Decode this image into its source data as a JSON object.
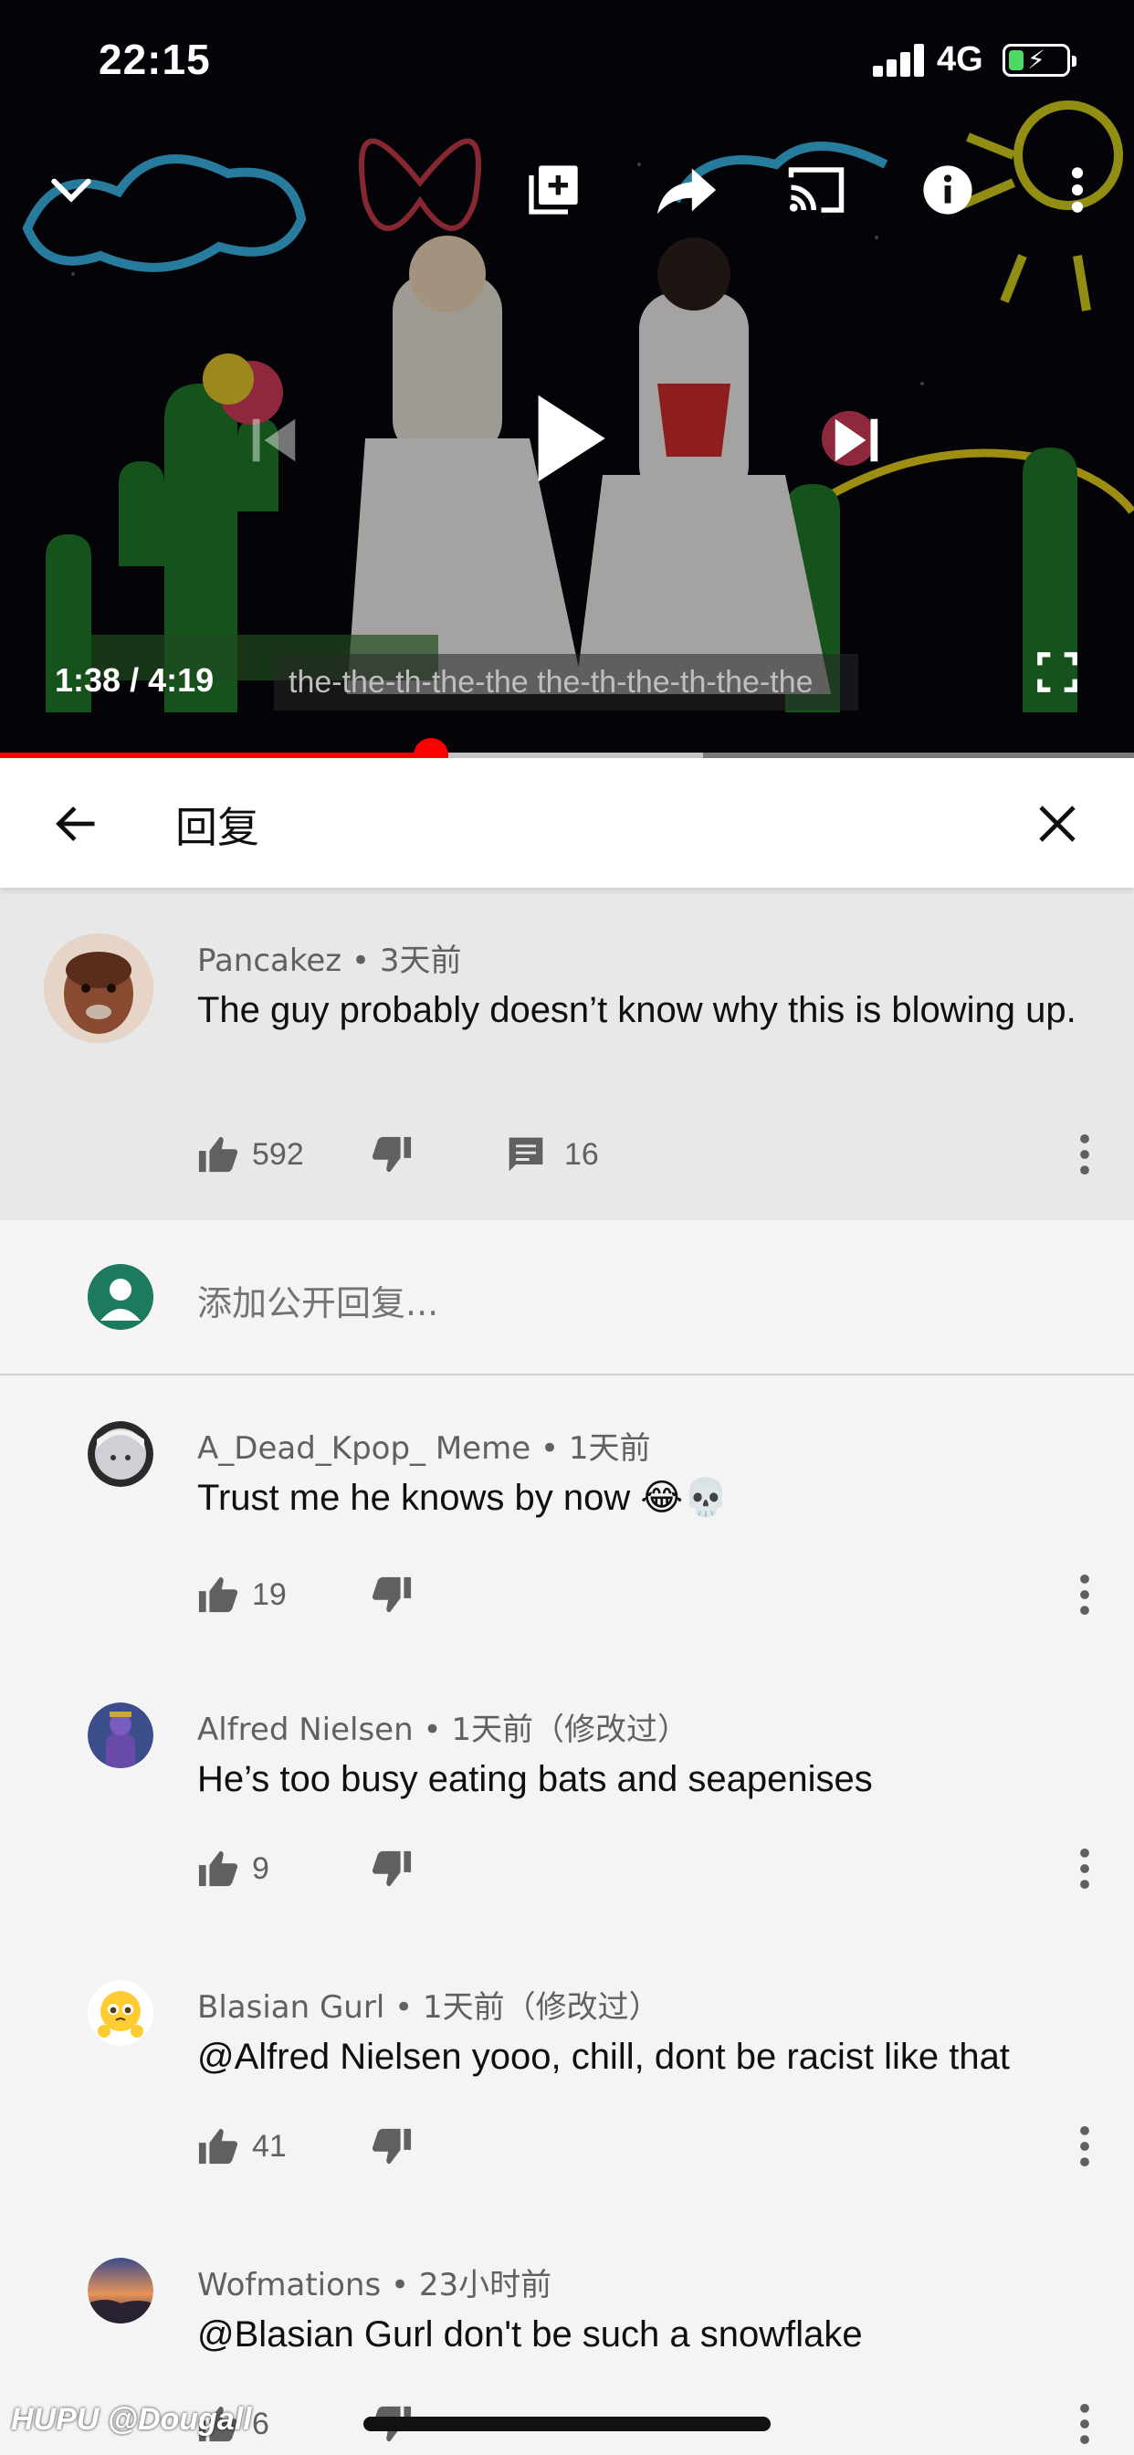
{
  "status_bar": {
    "time": "22:15",
    "network": "4G",
    "battery_level": 0.25,
    "charging": true
  },
  "player": {
    "current_time": "1:38",
    "separator": " / ",
    "duration": "4:19",
    "caption": "the-the-th-the-the the-th-the-th-the-the",
    "progress": 0.38,
    "buffered": 0.62,
    "colors": {
      "progress": "#ff0000",
      "buffer": "#c4c4c4"
    },
    "icons": [
      "collapse-icon",
      "add-to-playlist-icon",
      "share-icon",
      "cast-icon",
      "info-icon",
      "more-vert-icon",
      "previous-icon",
      "play-icon",
      "next-icon",
      "fullscreen-icon"
    ]
  },
  "replies_header": {
    "title": "回复",
    "icons": [
      "back-arrow-icon",
      "close-icon"
    ]
  },
  "parent_comment": {
    "author": "Pancakez",
    "age": "3天前",
    "text": "The guy probably doesn’t know why this is blowing up.",
    "likes": "592",
    "replies": "16"
  },
  "compose": {
    "placeholder": "添加公开回复..."
  },
  "replies": [
    {
      "author": "A_Dead_Kpop_ Meme",
      "age": "1天前",
      "text": "Trust me he knows by now 😂💀",
      "likes": "19"
    },
    {
      "author": "Alfred Nielsen",
      "age": "1天前（修改过）",
      "text": "He’s too busy eating bats and seapenises",
      "likes": "9"
    },
    {
      "author": "Blasian Gurl",
      "age": "1天前（修改过）",
      "text": "@Alfred Nielsen yooo, chill, dont be racist like that",
      "likes": "41"
    },
    {
      "author": "Wofmations",
      "age": "23小时前",
      "text": "@Blasian Gurl don't be such a snowflake",
      "likes": "6"
    }
  ],
  "meta_separator": " • ",
  "watermark": "HUPU @Dougall"
}
